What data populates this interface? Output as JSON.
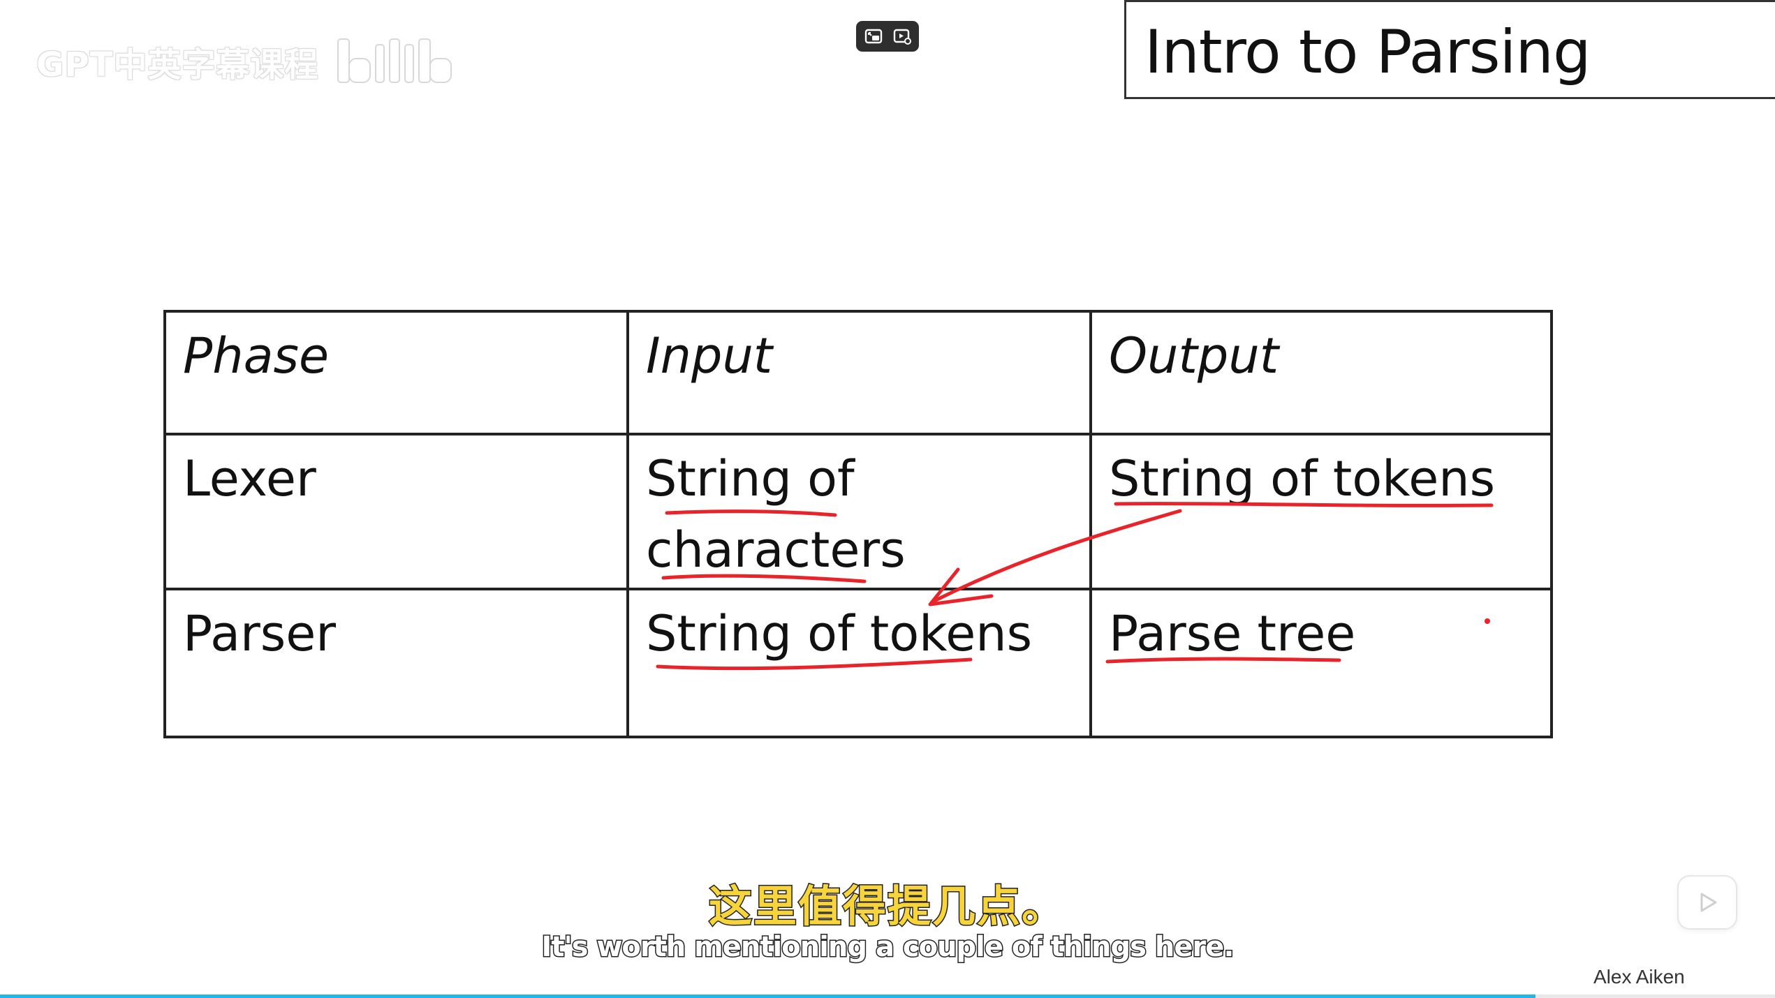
{
  "watermark": {
    "text": "GPT中英字幕课程",
    "logo_icon": "bilibili-logo-icon"
  },
  "player_controls": {
    "buttons": [
      {
        "icon": "picture-in-picture-icon"
      },
      {
        "icon": "video-settings-icon"
      }
    ]
  },
  "slide": {
    "title": "Intro to Parsing",
    "table": {
      "headers": [
        "Phase",
        "Input",
        "Output"
      ],
      "rows": [
        {
          "phase": "Lexer",
          "input_line1": "String of",
          "input_line2": "characters",
          "output": "String of tokens"
        },
        {
          "phase": "Parser",
          "input": "String of tokens",
          "output": "Parse tree"
        }
      ]
    },
    "annotation_color": "#e8242a"
  },
  "subtitles": {
    "zh": "这里值得提几点。",
    "en": "It's worth mentioning a couple of things here."
  },
  "credit": "Alex Aiken",
  "play_badge_icon": "play-icon",
  "progress": {
    "fraction": 0.865,
    "color": "#22b6e6"
  }
}
